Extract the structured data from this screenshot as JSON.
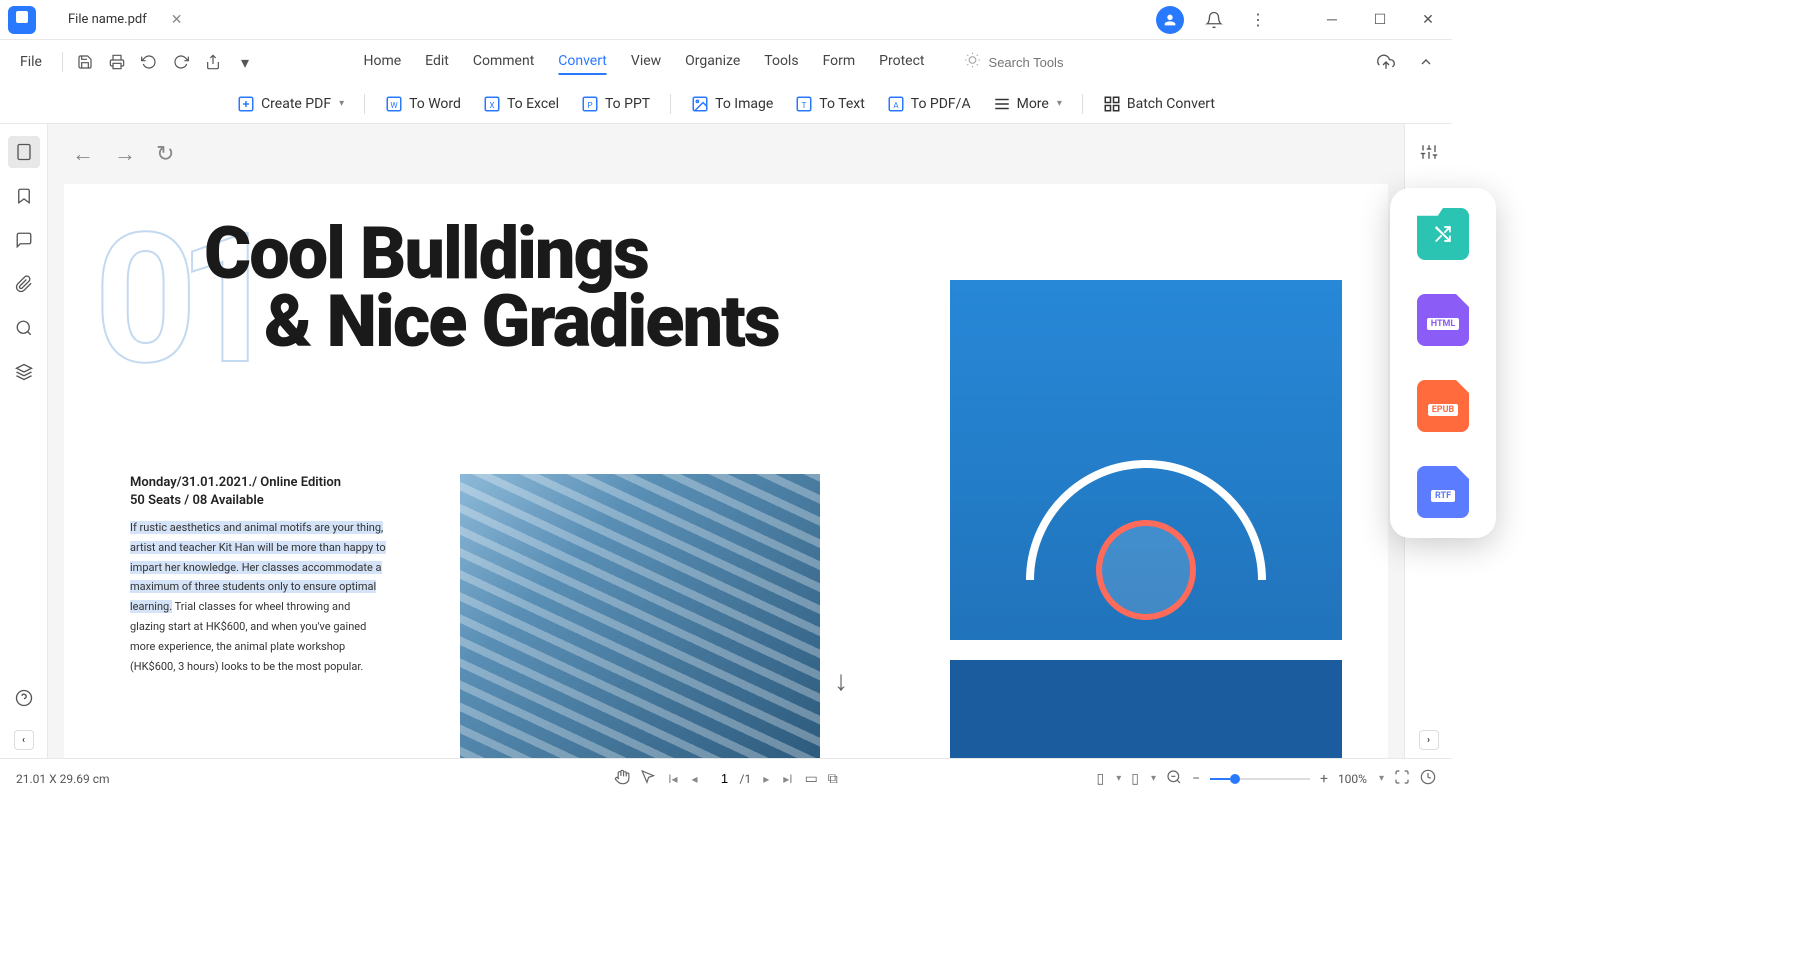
{
  "titleBar": {
    "tabName": "File name.pdf"
  },
  "menuBar": {
    "file": "File",
    "items": [
      "Home",
      "Edit",
      "Comment",
      "Convert",
      "View",
      "Organize",
      "Tools",
      "Form",
      "Protect"
    ],
    "activeIndex": 3,
    "searchPlaceholder": "Search Tools"
  },
  "toolbar": {
    "createPdf": "Create PDF",
    "toWord": "To Word",
    "toExcel": "To Excel",
    "toPpt": "To PPT",
    "toImage": "To Image",
    "toText": "To Text",
    "toPdfa": "To PDF/A",
    "more": "More",
    "batchConvert": "Batch Convert"
  },
  "document": {
    "bigNumber": "01",
    "headline1": "Cool Bulldings",
    "headline2": "& Nice Gradients",
    "subLine1": "Monday/31.01.2021./ Online Edition",
    "subLine2": "50 Seats / 08 Available",
    "bodyHighlighted": "If rustic aesthetics and animal motifs are your thing, artist and teacher Kit Han will be more than happy to impart her knowledge. Her classes accommodate a maximum of three students only to ensure optimal learning.",
    "bodyRest": " Trial classes for wheel throwing and glazing start at HK$600, and when you've gained more experience, the animal plate workshop (HK$600, 3 hours) looks to be the most popular."
  },
  "floatPanel": {
    "html": "HTML",
    "epub": "EPUB",
    "rtf": "RTF"
  },
  "statusBar": {
    "dimensions": "21.01 X 29.69 cm",
    "pageCurrent": "1",
    "pageTotal": "/1",
    "zoom": "100%"
  }
}
